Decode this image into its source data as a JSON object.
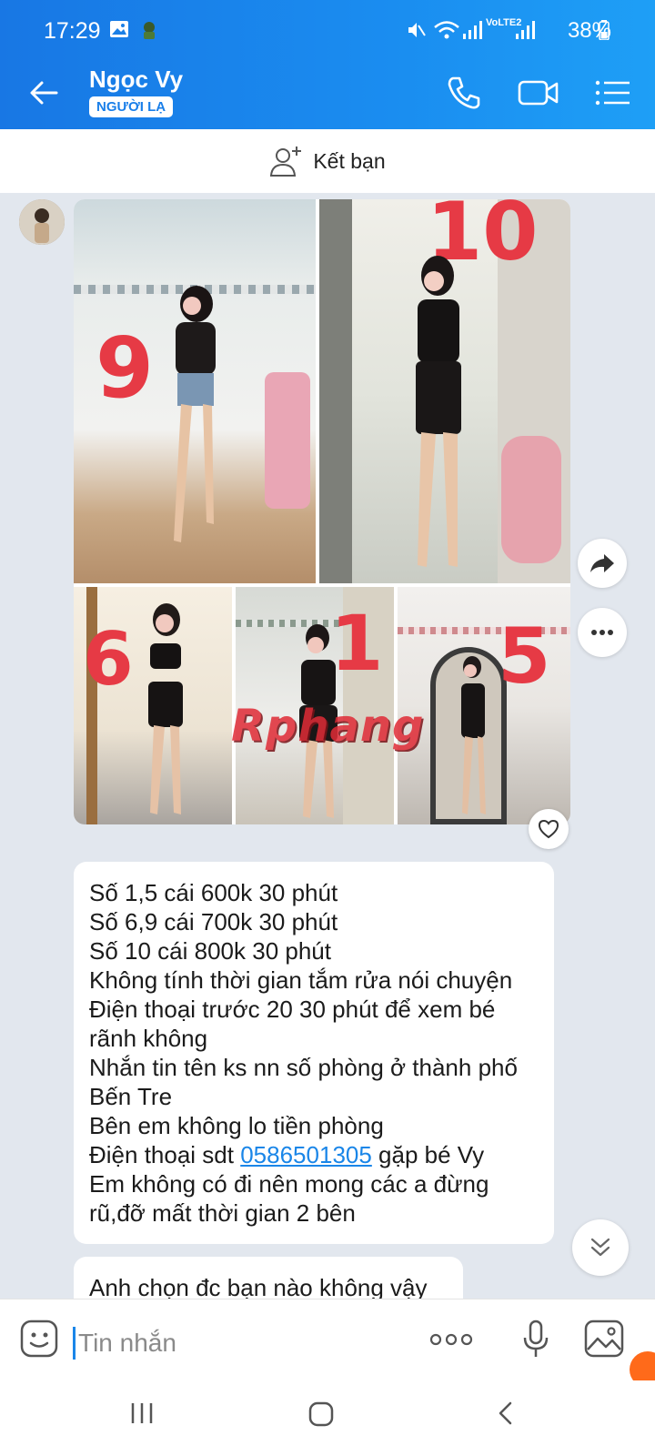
{
  "status_bar": {
    "time": "17:29",
    "battery": "38%",
    "network": "VoLTE2"
  },
  "header": {
    "contact_name": "Ngọc Vy",
    "contact_tag": "NGƯỜI LẠ"
  },
  "friend_bar": {
    "label": "Kết bạn"
  },
  "collage": {
    "photos": [
      {
        "number": "9"
      },
      {
        "number": "10"
      },
      {
        "number": "6"
      },
      {
        "number": "1"
      },
      {
        "number": "5"
      }
    ],
    "watermark": "Rphang"
  },
  "messages": {
    "msg1": {
      "line1": "Số 1,5 cái 600k 30 phút",
      "line2": "Số 6,9 cái 700k 30 phút",
      "line3": "Số 10 cái 800k 30 phút",
      "line4": "Không tính thời gian tắm rửa nói chuyện",
      "line5": "Điện thoại trước 20 30 phút để xem bé rãnh không",
      "line6": "Nhắn tin tên ks nn số phòng ở thành phố Bến Tre",
      "line7": "Bên em không lo tiền phòng",
      "line8_prefix": "Điện thoại sdt ",
      "line8_phone": "0586501305",
      "line8_suffix": " gặp bé Vy",
      "line9": "Em không có đi nên mong các a đừng rũ,đỡ mất thời gian 2 bên"
    },
    "msg2": {
      "text": "Anh chọn đc bạn nào không vậy"
    }
  },
  "input": {
    "placeholder": "Tin nhắn"
  },
  "colors": {
    "header_blue": "#1a8df0",
    "link": "#1a86e8",
    "number_red": "#e63a45",
    "chat_bg": "#e2e7ee"
  }
}
